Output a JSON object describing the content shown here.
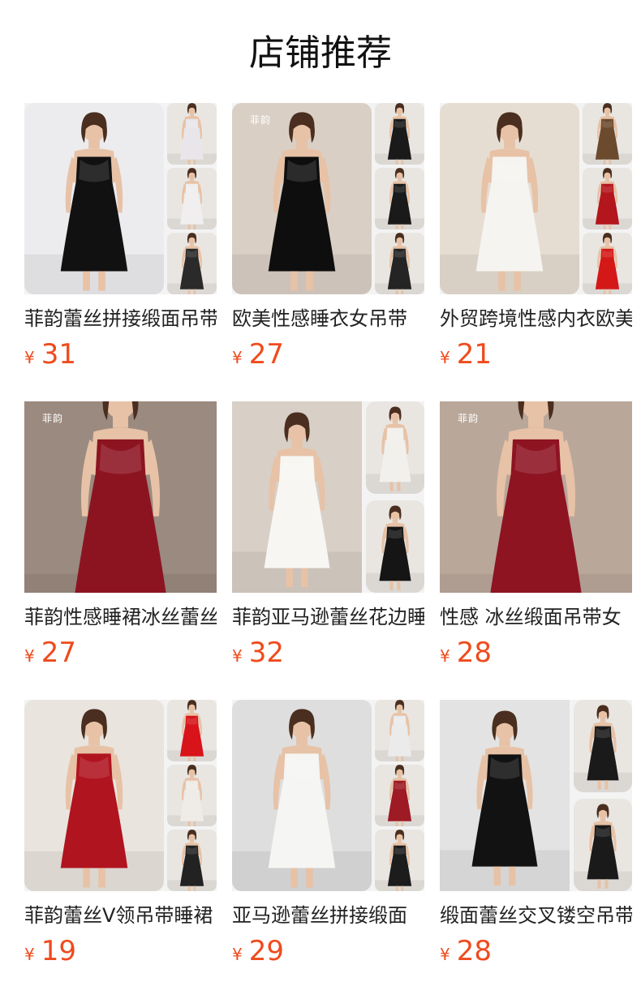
{
  "page_title": "店铺推荐",
  "currency_symbol": "¥",
  "colors": {
    "price": "#ef4b1d",
    "title": "#111111",
    "text": "#222222"
  },
  "products": [
    {
      "name": "菲韵蕾丝拼接缎面吊带",
      "price": "31",
      "layout": "collage",
      "dress_color": "#111111",
      "bg_color": "#ececef",
      "side_colors": [
        "#e8e6ea",
        "#f0eeee",
        "#2a2a2a"
      ],
      "brand_text": ""
    },
    {
      "name": "欧美性感睡衣女吊带",
      "price": "27",
      "layout": "collage",
      "dress_color": "#0e0e0e",
      "bg_color": "#d9cfc5",
      "side_colors": [
        "#1a1a1a",
        "#1a1a1a",
        "#242424"
      ],
      "brand_text": "菲韵"
    },
    {
      "name": "外贸跨境性感内衣欧美",
      "price": "21",
      "layout": "collage",
      "dress_color": "#f6f4f0",
      "bg_color": "#e6ddd2",
      "side_colors": [
        "#6b4a2e",
        "#b3161c",
        "#d41818"
      ],
      "brand_text": ""
    },
    {
      "name": "菲韵性感睡裙冰丝蕾丝",
      "price": "27",
      "layout": "full",
      "dress_color": "#8c1420",
      "bg_color": "#9b8a7f",
      "side_colors": [],
      "brand_text": "菲韵"
    },
    {
      "name": "菲韵亚马逊蕾丝花边睡",
      "price": "32",
      "layout": "two",
      "dress_color": "#f7f6f3",
      "bg_color": "#d8cfc6",
      "side_colors": [
        "#f2f0ec",
        "#151515"
      ],
      "brand_text": ""
    },
    {
      "name": "性感 冰丝缎面吊带女",
      "price": "28",
      "layout": "full",
      "dress_color": "#8e1422",
      "bg_color": "#b9a79a",
      "side_colors": [],
      "brand_text": "菲韵"
    },
    {
      "name": "菲韵蕾丝V领吊带睡裙",
      "price": "19",
      "layout": "collage",
      "dress_color": "#b0141f",
      "bg_color": "#e9e4de",
      "side_colors": [
        "#d8141a",
        "#efebe6",
        "#222222"
      ],
      "brand_text": ""
    },
    {
      "name": "亚马逊蕾丝拼接缎面",
      "price": "29",
      "layout": "collage",
      "dress_color": "#f5f5f3",
      "bg_color": "#dedede",
      "side_colors": [
        "#ebebeb",
        "#9e1a24",
        "#1c1c1c"
      ],
      "brand_text": ""
    },
    {
      "name": "缎面蕾丝交叉镂空吊带",
      "price": "28",
      "layout": "two",
      "dress_color": "#121212",
      "bg_color": "#e3e3e3",
      "side_colors": [
        "#1a1a1a",
        "#1a1a1a"
      ],
      "brand_text": ""
    }
  ]
}
